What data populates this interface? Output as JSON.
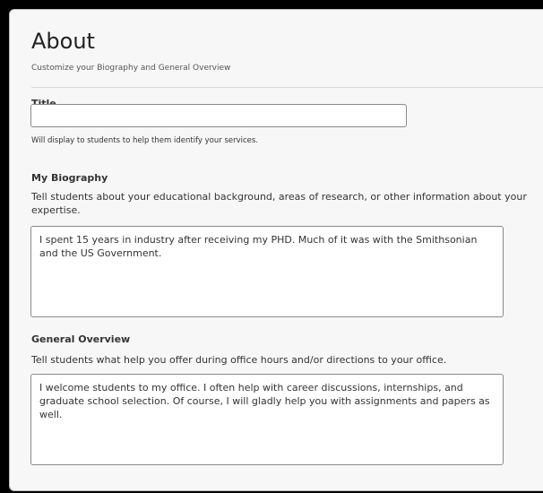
{
  "about": {
    "title": "About",
    "subtitle": "Customize your Biography and General Overview"
  },
  "title_field": {
    "label": "Title",
    "value": "",
    "help": "Will display to students to help them identify your services."
  },
  "biography": {
    "label": "My Biography",
    "help": "Tell students about your educational background, areas of research, or other information about your expertise.",
    "value": "I spent 15 years in industry after receiving my PHD. Much of it was with the Smithsonian and the US Government."
  },
  "overview": {
    "label": "General Overview",
    "help": "Tell students what help you offer during office hours and/or directions to your office.",
    "value": "I welcome students to my office. I often help with career discussions, internships, and graduate school selection. Of course, I will gladly help you with assignments and papers as well."
  }
}
